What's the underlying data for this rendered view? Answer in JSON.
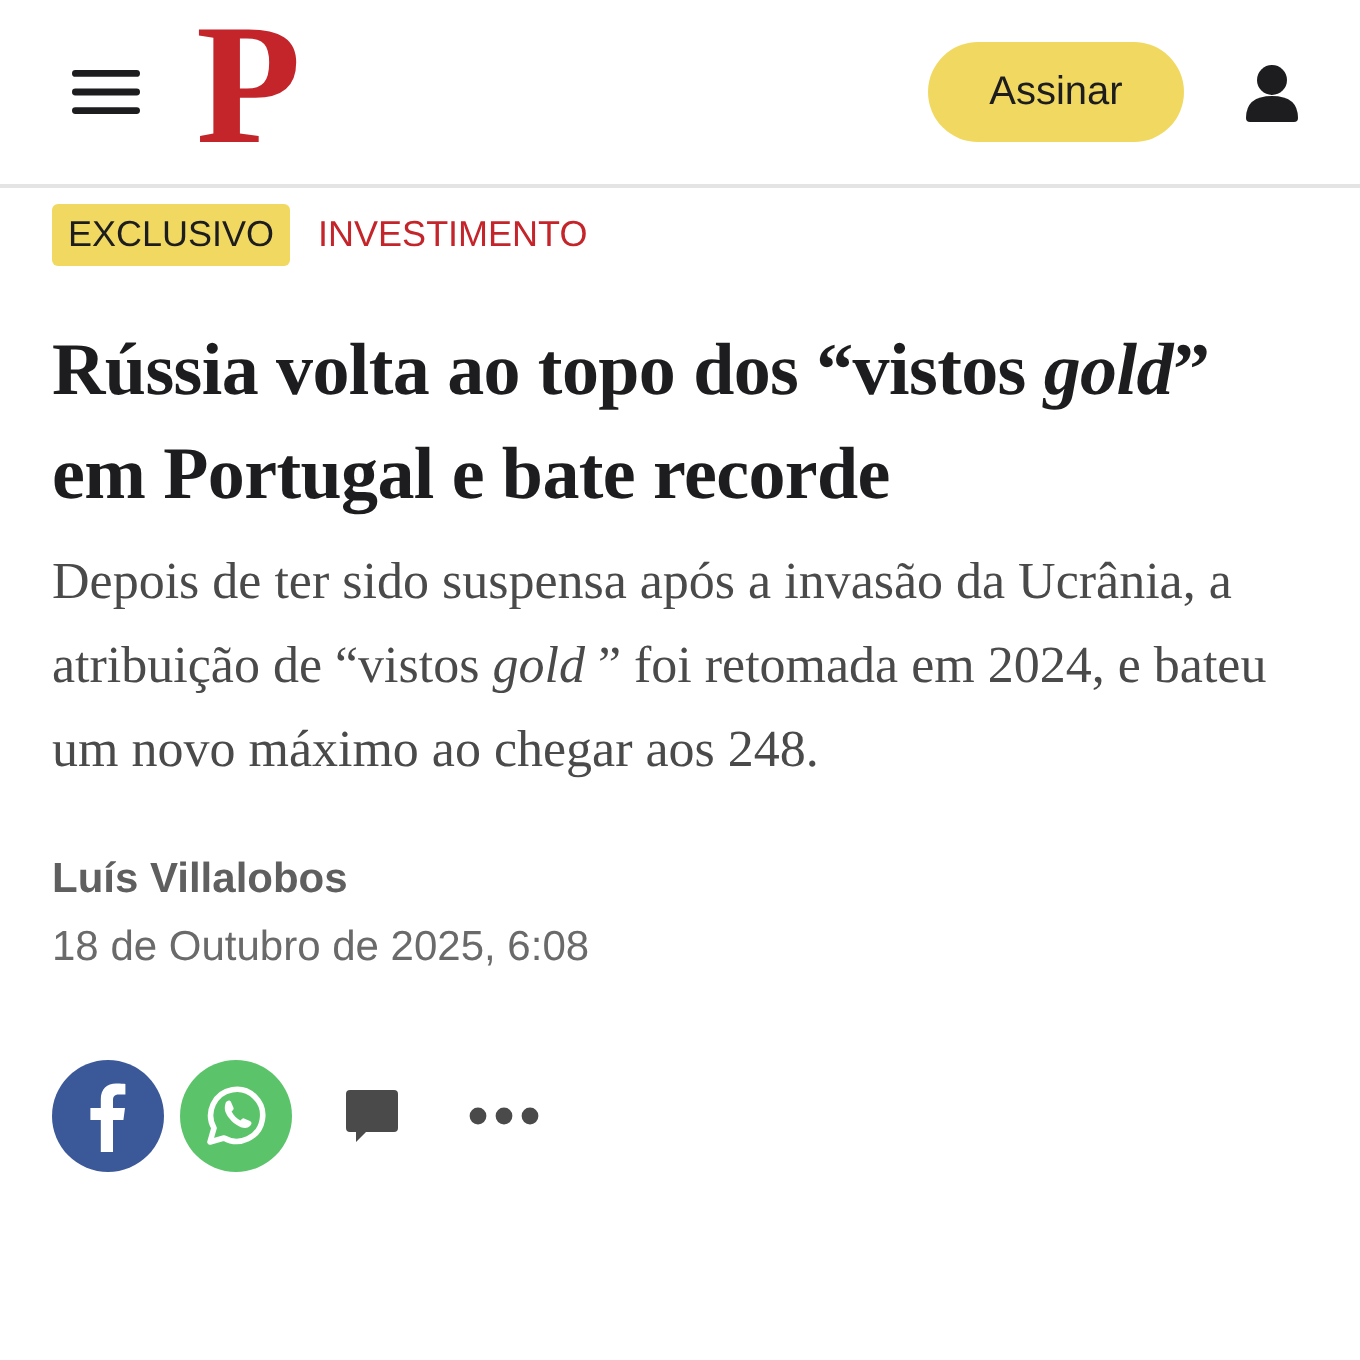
{
  "header": {
    "logo": "P",
    "subscribe_button": "Assinar"
  },
  "tags": [
    {
      "label": "EXCLUSIVO",
      "kind": "badge"
    },
    {
      "label": "INVESTIMENTO",
      "kind": "section"
    }
  ],
  "headline": "Rússia volta ao topo dos “vistos *gold*” em Portugal e bate recorde",
  "summary": "Depois de ter sido suspensa após a invasão da Ucrânia, a atribuição de “vistos *gold* ” foi retomada em 2024, e bateu um novo máximo ao chegar aos 248.",
  "author": "Luís Villalobos",
  "date": "18 de Outubro de 2025, 6:08",
  "share": [
    {
      "kind": "facebook"
    },
    {
      "kind": "whatsapp"
    },
    {
      "kind": "comment"
    },
    {
      "kind": "more"
    }
  ]
}
